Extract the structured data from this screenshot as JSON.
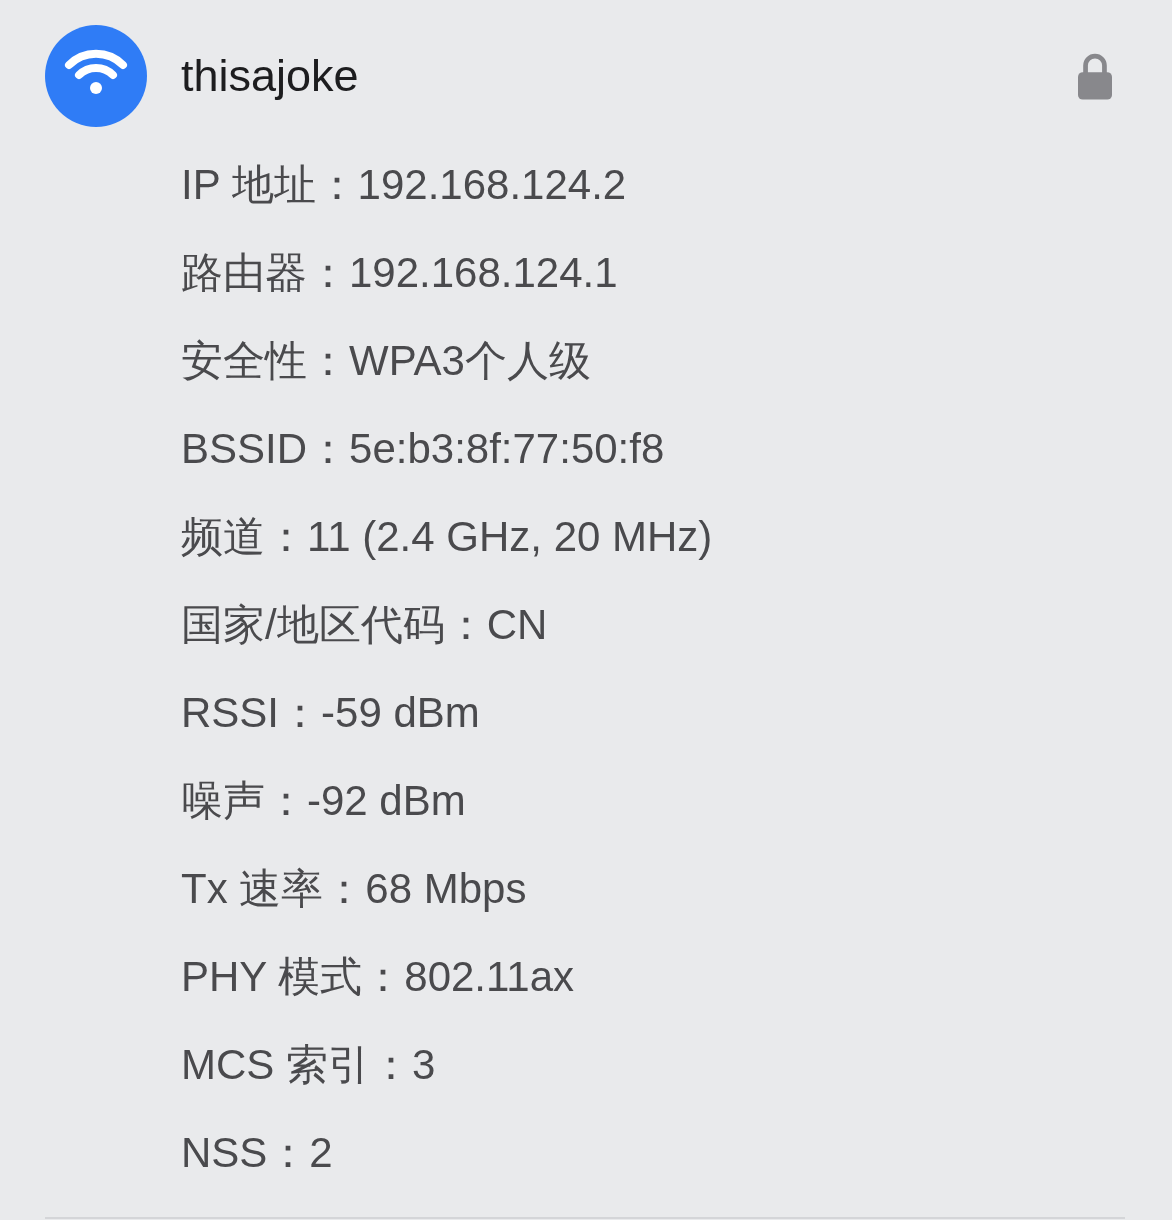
{
  "network": {
    "name": "thisajoke",
    "locked": true
  },
  "details": [
    {
      "label": "IP 地址：",
      "value": "192.168.124.2"
    },
    {
      "label": "路由器：",
      "value": "192.168.124.1"
    },
    {
      "label": "安全性：",
      "value": "WPA3个人级"
    },
    {
      "label": "BSSID：",
      "value": "5e:b3:8f:77:50:f8"
    },
    {
      "label": "频道：",
      "value": "11 (2.4 GHz, 20 MHz)"
    },
    {
      "label": "国家/地区代码：",
      "value": "CN"
    },
    {
      "label": "RSSI：",
      "value": "-59 dBm"
    },
    {
      "label": "噪声：",
      "value": "-92 dBm"
    },
    {
      "label": "Tx 速率：",
      "value": "68 Mbps"
    },
    {
      "label": "PHY 模式：",
      "value": "802.11ax"
    },
    {
      "label": "MCS 索引：",
      "value": "3"
    },
    {
      "label": "NSS：",
      "value": "2"
    }
  ]
}
